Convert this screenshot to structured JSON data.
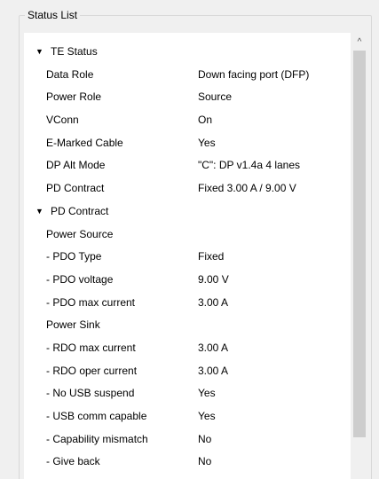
{
  "group": {
    "title": "Status List"
  },
  "scrollbar": {
    "up_glyph": "^"
  },
  "te_status": {
    "arrow": "▼",
    "label": "TE Status",
    "rows": [
      {
        "label": "Data Role",
        "value": "Down facing port (DFP)"
      },
      {
        "label": "Power Role",
        "value": "Source"
      },
      {
        "label": "VConn",
        "value": "On"
      },
      {
        "label": "E-Marked Cable",
        "value": "Yes"
      },
      {
        "label": "DP Alt Mode",
        "value": "\"C\": DP v1.4a 4 lanes"
      },
      {
        "label": "PD Contract",
        "value": "Fixed 3.00 A / 9.00 V"
      }
    ]
  },
  "pd_contract": {
    "arrow": "▼",
    "label": "PD Contract",
    "rows": [
      {
        "label": "Power Source",
        "value": ""
      },
      {
        "label": "- PDO Type",
        "value": "Fixed"
      },
      {
        "label": "- PDO voltage",
        "value": "9.00 V"
      },
      {
        "label": "- PDO max current",
        "value": "3.00 A"
      },
      {
        "label": "Power Sink",
        "value": ""
      },
      {
        "label": "- RDO max current",
        "value": "3.00 A"
      },
      {
        "label": "- RDO oper current",
        "value": "3.00 A"
      },
      {
        "label": "- No USB suspend",
        "value": "Yes"
      },
      {
        "label": "- USB comm capable",
        "value": "Yes"
      },
      {
        "label": "- Capability mismatch",
        "value": "No"
      },
      {
        "label": "- Give back",
        "value": "No"
      }
    ]
  }
}
